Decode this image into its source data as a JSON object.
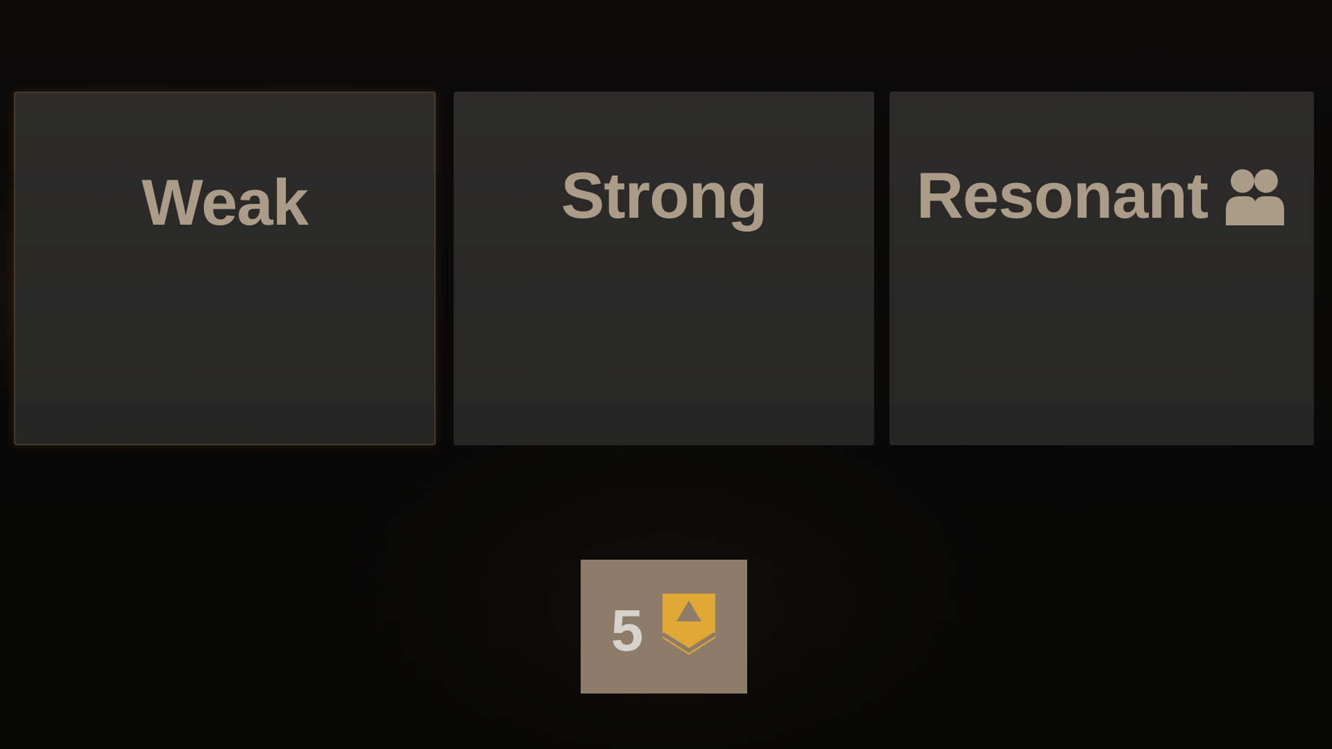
{
  "cards": [
    {
      "id": "weak",
      "label": "Weak",
      "selected": true
    },
    {
      "id": "strong",
      "label": "Strong",
      "selected": false
    },
    {
      "id": "resonant",
      "label": "Resonant",
      "icon": "group-icon",
      "selected": false
    }
  ],
  "counter": {
    "value": "5",
    "icon": "rank-chevron-icon"
  },
  "colors": {
    "card_text": "#ab9c88",
    "card_bg": "#2b2a29",
    "counter_bg": "#8c7c69",
    "counter_text": "#d6d2cc",
    "rank_badge": "#e0a832"
  }
}
